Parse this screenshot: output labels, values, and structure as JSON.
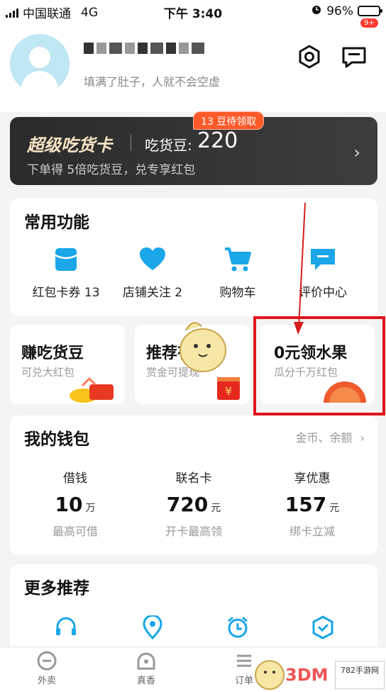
{
  "status_bar": {
    "carrier": "中国联通",
    "network": "4G",
    "time": "下午 3:40",
    "battery": "96%"
  },
  "profile": {
    "slogan": "填满了肚子，人就不会空虚",
    "message_badge": "9+"
  },
  "super_card": {
    "title": "超级吃货卡",
    "beans_label": "吃货豆:",
    "beans_value": "220",
    "desc": "下单得 5倍吃货豆，兑专享红包",
    "pending_tag": "13 豆待领取"
  },
  "common": {
    "title": "常用功能",
    "items": [
      {
        "label": "红包卡券 13",
        "icon": "coupon-icon"
      },
      {
        "label": "店铺关注 2",
        "icon": "heart-icon"
      },
      {
        "label": "购物车",
        "icon": "cart-icon"
      },
      {
        "label": "评价中心",
        "icon": "review-icon"
      }
    ]
  },
  "promos": [
    {
      "title": "赚吃货豆",
      "subtitle": "可兑大红包"
    },
    {
      "title": "推荐有奖",
      "subtitle": "赏金可提现"
    },
    {
      "title": "0元领水果",
      "subtitle": "瓜分千万红包"
    }
  ],
  "wallet": {
    "title": "我的钱包",
    "link": "金币、余额",
    "columns": [
      {
        "label": "借钱",
        "value": "10",
        "unit": "万",
        "sub": "最高可借"
      },
      {
        "label": "联名卡",
        "value": "720",
        "unit": "元",
        "sub": "开卡最高领"
      },
      {
        "label": "享优惠",
        "value": "157",
        "unit": "元",
        "sub": "绑卡立减"
      }
    ]
  },
  "more": {
    "title": "更多推荐"
  },
  "tabs": [
    {
      "label": "外卖"
    },
    {
      "label": "真香"
    },
    {
      "label": "订单"
    }
  ],
  "watermark": {
    "text": "3DM",
    "site": "782手游网"
  },
  "colors": {
    "accent": "#1aa6e8",
    "highlight": "#e0151c",
    "tag": "#ff5a2a"
  }
}
